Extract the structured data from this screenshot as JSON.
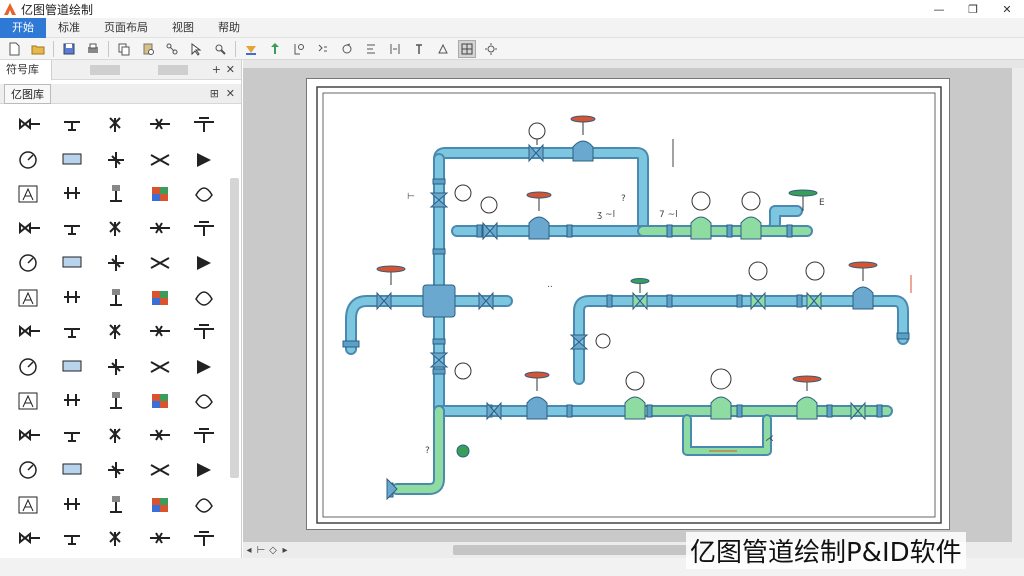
{
  "window": {
    "title": "亿图管道绘制",
    "logo_color": "#e8622a",
    "controls": {
      "minimize": "—",
      "maximize": "❐",
      "close": "✕"
    }
  },
  "menu": {
    "items": [
      "开始",
      "标准",
      "页面布局",
      "视图",
      "帮助"
    ],
    "active_index": 0,
    "active_color": "#2f79d6"
  },
  "toolbar": {
    "icons": [
      "new-icon",
      "open-icon",
      "save-icon",
      "print-icon",
      "copy-icon",
      "paste-icon",
      "connector-icon",
      "pointer-icon",
      "line-icon",
      "fill-icon",
      "arrange-icon",
      "group-icon",
      "zoom-icon",
      "rotate-icon",
      "align-icon",
      "distribute-icon",
      "grid-icon",
      "settings-icon"
    ]
  },
  "left_panel": {
    "tabs": [
      "符号库"
    ],
    "library_title": "亿图库",
    "pin_label": "⊞",
    "close_label": "✕",
    "add_label": "+",
    "symbols": [
      "gate-valve",
      "check-valve",
      "angle-valve",
      "globe-valve",
      "ball-valve",
      "butterfly-valve",
      "needle-valve",
      "cross-fitting",
      "plug-valve",
      "diaphragm-valve",
      "flange",
      "reducer",
      "pressure-gauge",
      "temperature-gauge",
      "flow-meter",
      "relief-valve",
      "control-valve",
      "solenoid-valve",
      "filter-element",
      "tee-fitting",
      "x-valve",
      "swing-check",
      "wafer-valve",
      "3-way-valve",
      "4-way-valve",
      "pump",
      "strainer",
      "float-valve",
      "gauge-dial",
      "dome-gauge",
      "cross-x",
      "nozzle",
      "orifice",
      "union",
      "piston-valve",
      "play-pump",
      "annotation-a",
      "dial-gauge",
      "sight-glass",
      "butterfly-v",
      "actuator",
      "diaphragm-actuator",
      "motor-valve",
      "sight-indicator",
      "color-block",
      "hand-valve",
      "lever-valve",
      "nozzle-spray",
      "shield-color",
      "color-grid",
      "steam-trap",
      "gauge-small",
      "gauge-round",
      "search-gauge",
      "u-trap",
      "pipe-support",
      "filter",
      "relief-b",
      "round-indicator",
      "line-end",
      "cross-small",
      "vial",
      "flag-marker",
      "line-tick",
      "line-long"
    ],
    "accent": "#5b7bd6"
  },
  "canvas": {
    "page_bg": "#ffffff",
    "pipe_blue": "#7cc6e0",
    "pipe_green": "#8fdca2",
    "valve_red": "#d9532f",
    "valve_green": "#3a9d5a"
  },
  "bottom": {
    "buttons": [
      "◂",
      "⊢",
      "◇",
      "▸"
    ]
  },
  "watermark": "亿图管道绘制P&ID软件"
}
